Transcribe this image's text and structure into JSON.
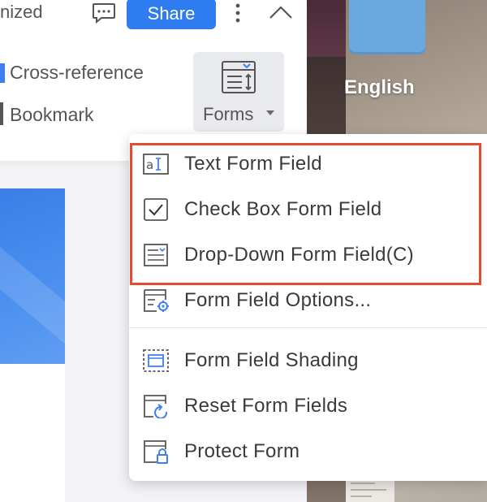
{
  "toolbar": {
    "partial_label": "nized",
    "share_label": "Share",
    "cross_reference_label": "Cross-reference",
    "bookmark_label": "Bookmark",
    "forms_label": "Forms"
  },
  "background": {
    "english_text": "English"
  },
  "forms_menu": {
    "items": [
      {
        "label": "Text Form Field",
        "icon": "text-form-field-icon"
      },
      {
        "label": "Check Box Form Field",
        "icon": "checkbox-icon"
      },
      {
        "label": "Drop-Down Form Field(C)",
        "icon": "dropdown-field-icon"
      },
      {
        "label": "Form Field Options...",
        "icon": "form-field-options-icon"
      },
      {
        "label": "Form Field Shading",
        "icon": "field-shading-icon"
      },
      {
        "label": "Reset Form Fields",
        "icon": "reset-form-icon"
      },
      {
        "label": "Protect Form",
        "icon": "protect-form-icon"
      }
    ]
  },
  "colors": {
    "accent": "#2f7bf0",
    "highlight_border": "#e34c33",
    "icon_gray": "#555555",
    "icon_blue": "#3d7ff0"
  }
}
